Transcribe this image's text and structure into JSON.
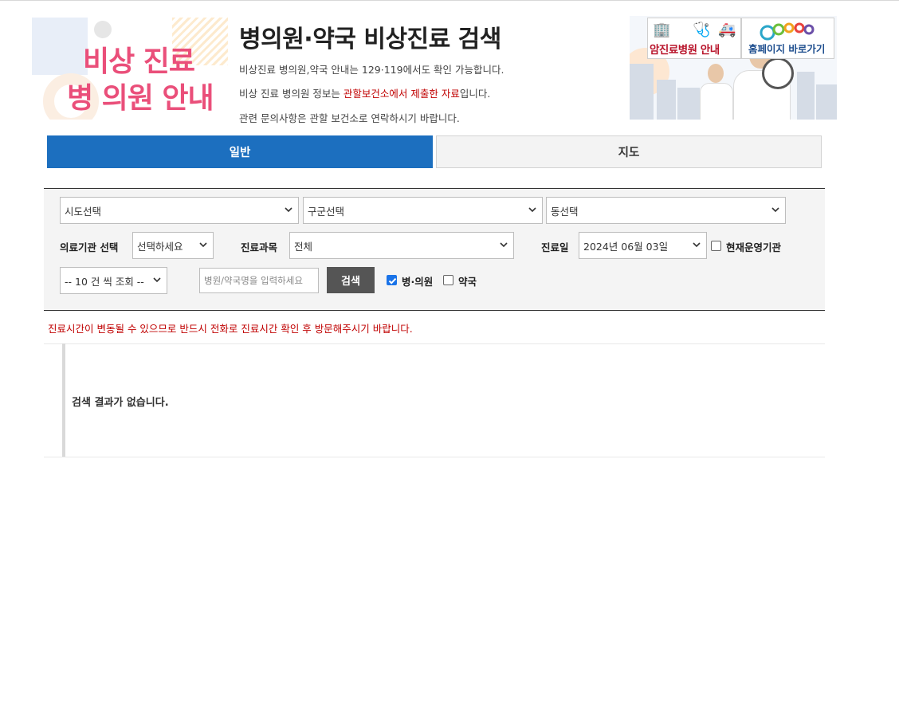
{
  "header": {
    "logo_line1": "비상 진료",
    "logo_line2": "병 의원 안내",
    "title": "병의원·약국 비상진료 검색",
    "info1": "비상진료 병의원,약국 안내는 129·119에서도 확인 가능합니다.",
    "info2_prefix": "비상 진료 병의원 정보는 ",
    "info2_highlight": "관할보건소에서 제출한 자료",
    "info2_suffix": "입니다.",
    "info3": "관련 문의사항은 관할 보건소로 연락하시기 바랍니다.",
    "highlight_color": "#c00000",
    "banner_cancer_label": "암진료병원 안내",
    "banner_home_label": "홈페이지 바로가기"
  },
  "tabs": [
    {
      "label": "일반",
      "active": true
    },
    {
      "label": "지도",
      "active": false
    }
  ],
  "search": {
    "sido": "시도선택",
    "gugun": "구군선택",
    "dong": "동선택",
    "institution_label": "의료기관 선택",
    "institution_value": "선택하세요",
    "department_label": "진료과목",
    "department_value": "전체",
    "date_label": "진료일",
    "date_value": "2024년 06월 03일",
    "open_now_label": "현재운영기관",
    "open_now_checked": false,
    "page_size": "-- 10 건 씩 조회 --",
    "keyword_placeholder": "병원/약국명을 입력하세요",
    "search_button": "검색",
    "hospital_label": "병·의원",
    "hospital_checked": true,
    "pharmacy_label": "약국",
    "pharmacy_checked": false
  },
  "notice": "진료시간이 변동될 수 있으므로 반드시 전화로 진료시간 확인 후 방문해주시기 바랍니다.",
  "results": {
    "empty_message": "검색 결과가 없습니다."
  },
  "colors": {
    "accent_blue": "#1c6fbf",
    "logo_pink": "#ea4f7a",
    "warning_red": "#c00000"
  }
}
